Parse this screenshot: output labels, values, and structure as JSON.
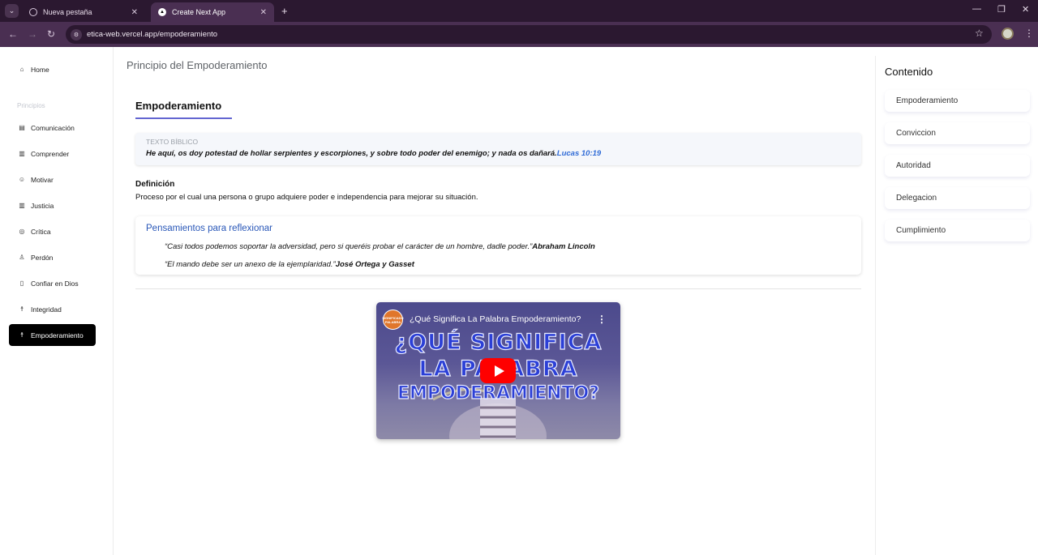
{
  "browser": {
    "tabs": [
      {
        "title": "Nueva pestaña",
        "active": false
      },
      {
        "title": "Create Next App",
        "active": true
      }
    ],
    "url": "etica-web.vercel.app/empoderamiento"
  },
  "sidebar": {
    "home_label": "Home",
    "section_label": "Principios",
    "items": [
      {
        "label": "Comunicación",
        "icon": "book-icon"
      },
      {
        "label": "Comprender",
        "icon": "notebook-icon"
      },
      {
        "label": "Motivar",
        "icon": "smile-icon"
      },
      {
        "label": "Justicia",
        "icon": "columns-icon"
      },
      {
        "label": "Crítica",
        "icon": "compass-icon"
      },
      {
        "label": "Perdón",
        "icon": "user-icon"
      },
      {
        "label": "Confiar en Dios",
        "icon": "book-icon"
      },
      {
        "label": "Integridad",
        "icon": "person-icon"
      },
      {
        "label": "Empoderamiento",
        "icon": "person-icon",
        "active": true
      }
    ]
  },
  "main": {
    "page_title": "Principio del Empoderamiento",
    "heading": "Empoderamiento",
    "bible": {
      "label": "TEXTO BÍBLICO",
      "text": "He aquí, os doy potestad de hollar serpientes y escorpiones, y sobre todo poder del enemigo; y nada os dañará.",
      "reference": "Lucas 10:19"
    },
    "definition": {
      "label": "Definición",
      "text": "Proceso por el cual una persona o grupo adquiere poder e independencia para mejorar su situación."
    },
    "thoughts": {
      "title": "Pensamientos para reflexionar",
      "quotes": [
        {
          "text": "“Casi todos podemos soportar la adversidad, pero si queréis probar el carácter de un hombre, dadle poder.”",
          "author": "Abraham Lincoln"
        },
        {
          "text": "“El mando debe ser un anexo de la ejemplaridad.”",
          "author": "José Ortega y Gasset"
        }
      ]
    },
    "video": {
      "title": "¿Qué Significa La Palabra Empoderamiento?",
      "channel_badge": "SIGNIFICADO PALABRA",
      "overlay_lines": [
        "¿QUÉ SIGNIFICA",
        "LA PALABRA",
        "EMPODERAMIENTO?"
      ]
    }
  },
  "toc": {
    "title": "Contenido",
    "items": [
      "Empoderamiento",
      "Conviccion",
      "Autoridad",
      "Delegacion",
      "Cumplimiento"
    ]
  }
}
